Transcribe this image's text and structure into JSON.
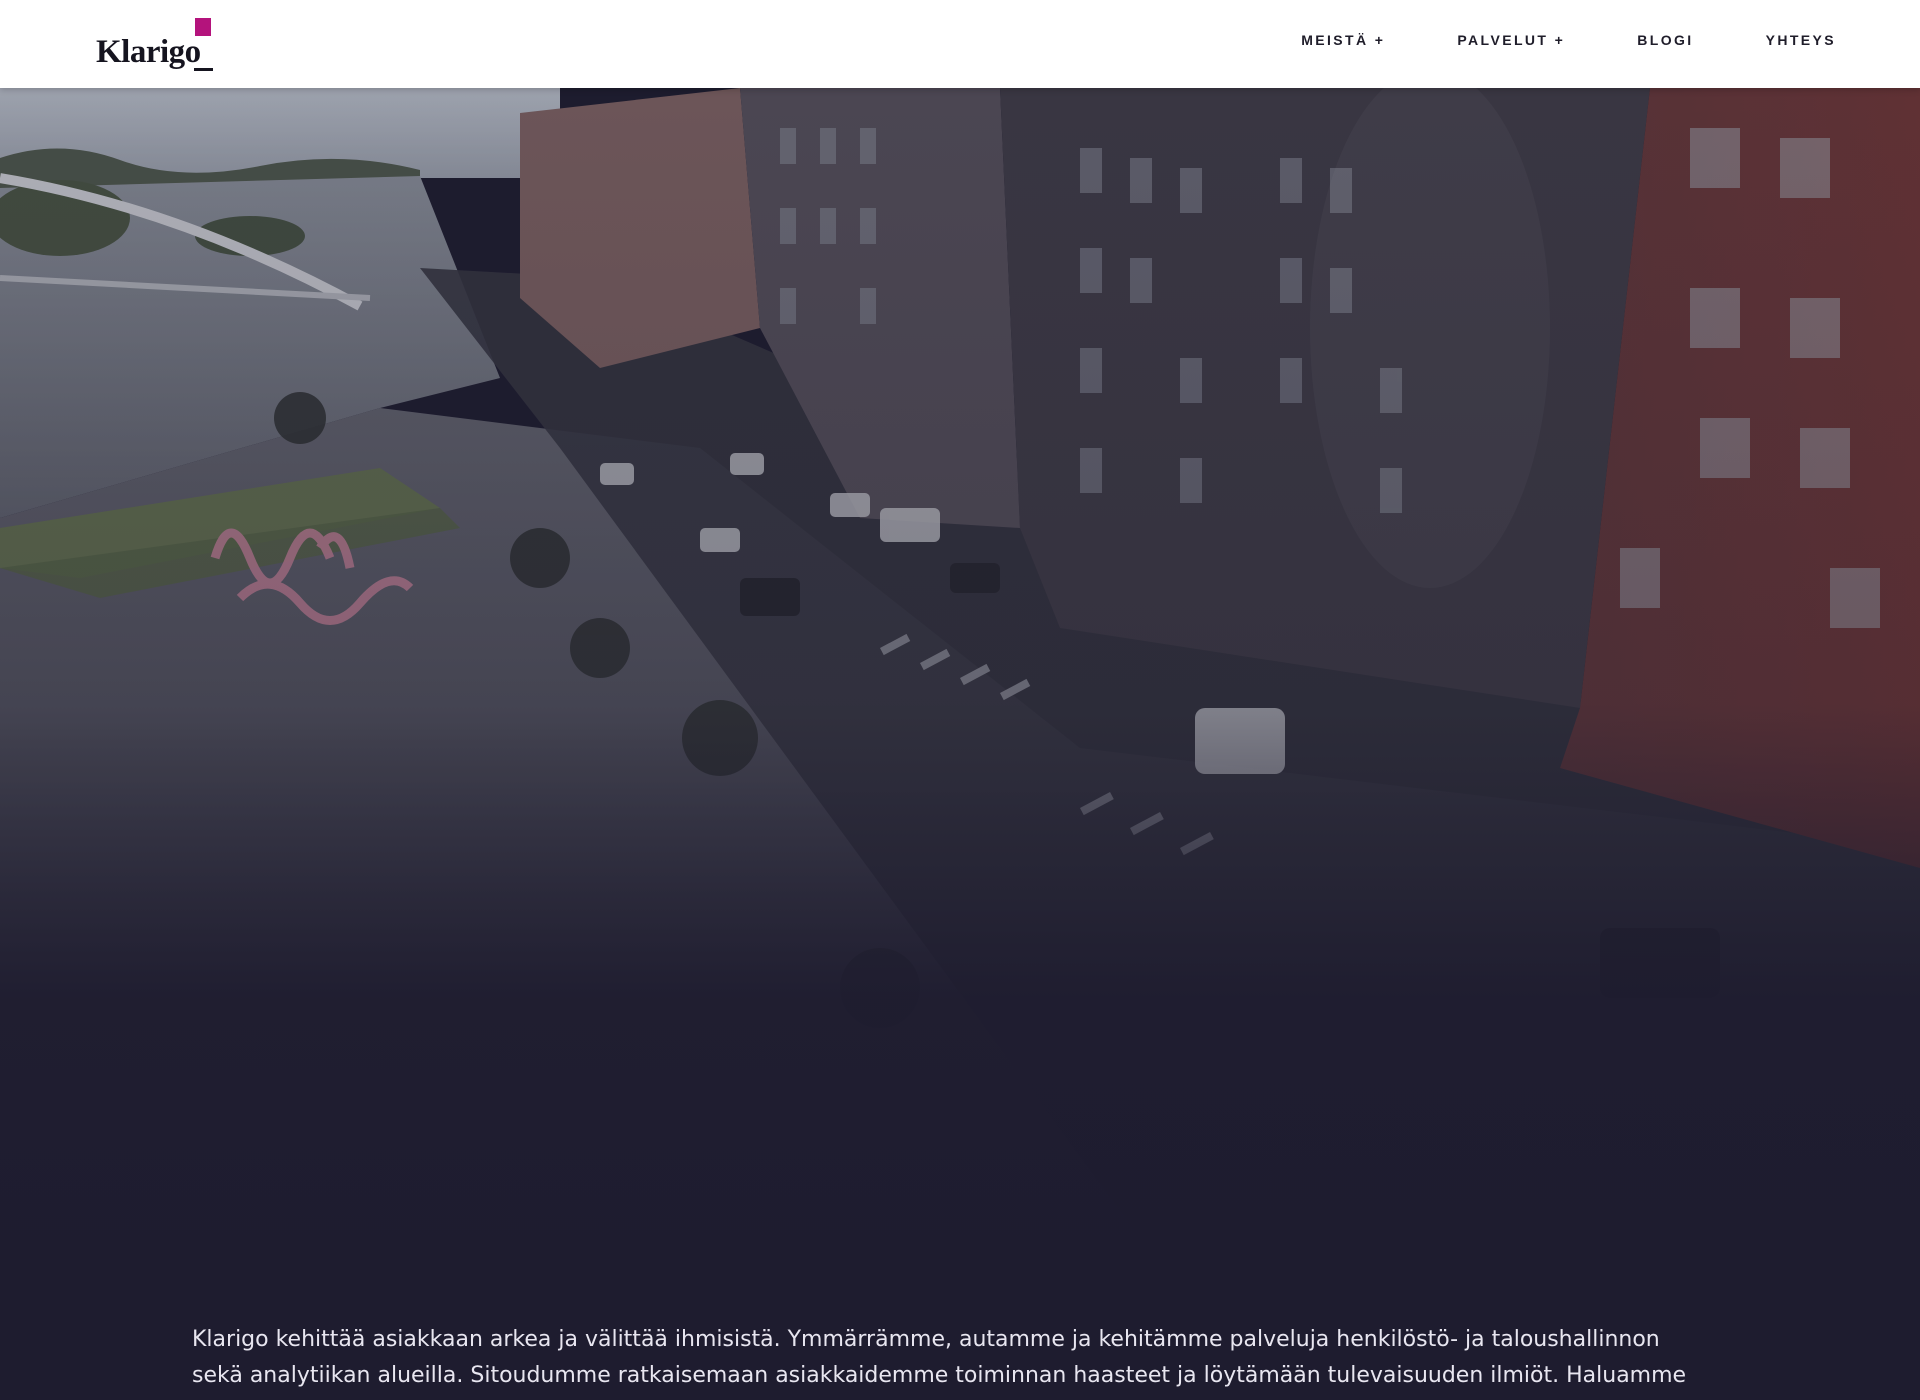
{
  "brand": {
    "name": "Klarigo",
    "accent_color": "#b4137c",
    "text_color": "#15141f"
  },
  "nav": {
    "items": [
      {
        "label": "MEISTÄ +"
      },
      {
        "label": "PALVELUT +"
      },
      {
        "label": "BLOGI"
      },
      {
        "label": "YHTEYS"
      }
    ]
  },
  "hero": {
    "overlay_color": "#1e1c2f",
    "image_subject": "city-waterfront-photo"
  },
  "intro": {
    "text": "Klarigo kehittää asiakkaan arkea ja välittää ihmisistä. Ymmärrämme, autamme ja kehitämme palveluja henkilöstö- ja taloushallinnon sekä analytiikan alueilla. Sitoudumme ratkaisemaan asiakkaidemme toiminnan haasteet ja löytämään tulevaisuuden ilmiöt. Haluamme olla asiakkaillemme paras"
  }
}
